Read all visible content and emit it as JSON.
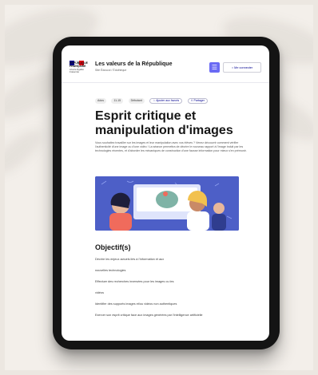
{
  "header": {
    "org_line1": "RÉPUBLIQUE",
    "org_line2": "FRANÇAISE",
    "org_motto": "Liberté Égalité Fraternité",
    "site_title": "Les valeurs de la République",
    "site_subtitle": "Site Éduscol / Éduthèque",
    "menu_icon": "☰",
    "login_label": "Me connecter"
  },
  "tags": [
    "Ados",
    "11-15",
    "Débutant",
    "Ajouter aux favoris",
    "Partager"
  ],
  "page": {
    "title": "Esprit critique et manipulation d'images",
    "intro": "Vous souhaitez travailler sur les images et leur manipulation avec vos élèves ? Venez découvrir comment vérifier l'authenticité d'une image ou d'une vidéo ! La séance permettra de décrire le nouveau rapport à l'image induit par les technologies récentes, et d'aborder les mécaniques de construction d'une fausse information pour mieux s'en prémunir."
  },
  "objectives": {
    "heading": "Objectif(s)",
    "items": [
      "Décrire les enjeux actuels liés à l'information et aux",
      "nouvelles technologies",
      "Effectuer des recherches inversées pour les images ou les",
      "vidéos",
      "Identifier des supports images et/ou vidéos non authentiques",
      "Exercer son esprit critique face aux images générées par l'intelligence artificielle"
    ]
  },
  "colors": {
    "accent": "#6a6af4",
    "illustration_bg": "#4d5fc7",
    "flag_blue": "#000091",
    "flag_red": "#e1000f"
  },
  "icons": {
    "menu": "hamburger-menu-icon",
    "login": "user-icon",
    "favorite": "star-icon",
    "share": "share-icon"
  }
}
